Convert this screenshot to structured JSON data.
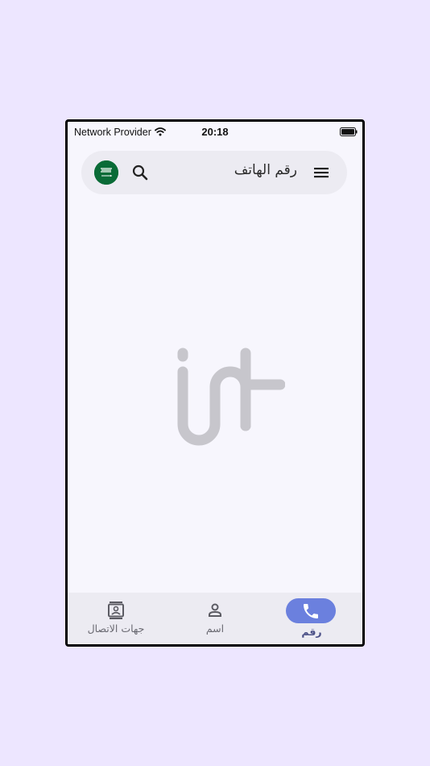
{
  "status_bar": {
    "provider": "Network Provider",
    "time": "20:18"
  },
  "search_bar": {
    "title": "رقم الهاتف",
    "flag_icon": "saudi-flag-icon",
    "search_icon": "search-icon",
    "menu_icon": "menu-icon"
  },
  "logo": {
    "icon": "brand-logo"
  },
  "bottom_nav": {
    "items": [
      {
        "label": "جهات الاتصال",
        "icon": "contacts-icon",
        "active": false
      },
      {
        "label": "اسم",
        "icon": "person-icon",
        "active": false
      },
      {
        "label": "رقم",
        "icon": "phone-icon",
        "active": true
      }
    ]
  },
  "colors": {
    "background": "#ede6ff",
    "screen": "#f7f6fd",
    "bar": "#ecebf2",
    "accent": "#6b80de",
    "flag": "#0a6b37",
    "logo": "#c7c6cc"
  }
}
